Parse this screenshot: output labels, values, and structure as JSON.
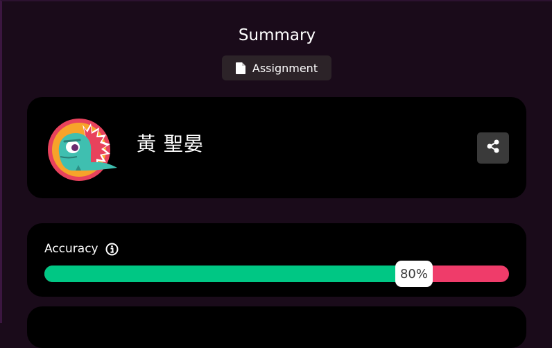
{
  "header": {
    "title": "Summary",
    "type_badge": {
      "label": "Assignment",
      "icon": "document-icon"
    }
  },
  "profile": {
    "name": "黃 聖晏",
    "avatar_icon": "dinosaur-avatar-icon",
    "share_icon": "share-icon"
  },
  "accuracy": {
    "label": "Accuracy",
    "info_icon": "info-icon",
    "value_text": "80%",
    "value_fraction": 0.8,
    "colors": {
      "correct": "#00c784",
      "incorrect": "#ef3c6a"
    }
  }
}
